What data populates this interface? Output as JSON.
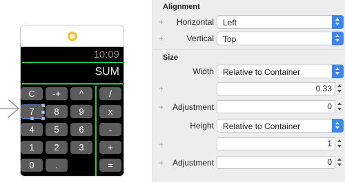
{
  "watch": {
    "time": "10:09",
    "display": "SUM",
    "keys": [
      "C",
      "-+",
      "^",
      "/",
      "7",
      "8",
      "9",
      "x",
      "4",
      "5",
      "6",
      "-",
      "1",
      "2",
      "3",
      "+",
      "0",
      ".",
      "="
    ]
  },
  "inspector": {
    "alignment": {
      "title": "Alignment",
      "horizontal_label": "Horizontal",
      "horizontal_value": "Left",
      "vertical_label": "Vertical",
      "vertical_value": "Top"
    },
    "size": {
      "title": "Size",
      "width_label": "Width",
      "width_value": "Relative to Container",
      "width_multiplier": "0.33",
      "width_adjustment_label": "Adjustment",
      "width_adjustment": "0",
      "height_label": "Height",
      "height_value": "Relative to Container",
      "height_multiplier": "1",
      "height_adjustment_label": "Adjustment",
      "height_adjustment": "0"
    },
    "plus_symbol": "+"
  },
  "colors": {
    "accent": "#3a86f2",
    "watch_green": "#2ec24f",
    "key_gray": "#5c5c5c",
    "app_icon": "#f3c33b"
  }
}
